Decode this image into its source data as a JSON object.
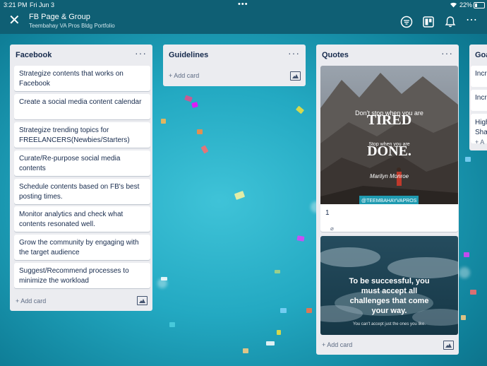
{
  "status_bar": {
    "time": "3:21 PM",
    "date": "Fri Jun 3",
    "battery": "22%"
  },
  "header": {
    "board_title": "FB Page & Group",
    "team_name": "Teembahay VA Pros Bldg Portfolio",
    "icons": [
      "close-icon",
      "filter-icon",
      "board-view-icon",
      "bell-icon",
      "more-icon"
    ]
  },
  "lists": {
    "facebook": {
      "title": "Facebook",
      "cards": [
        "Strategize contents that works on Facebook",
        "Create a social media content calendar",
        "Strategize trending topics for FREELANCERS(Newbies/Starters)",
        "Curate/Re-purpose social media contents",
        "Schedule contents based on FB's best posting times.",
        "Monitor analytics and check what contents resonated well.",
        "Grow the community by engaging with the target audience",
        "Suggest/Recommend processes to minimize the workload"
      ],
      "add_card": "+ Add card"
    },
    "guidelines": {
      "title": "Guidelines",
      "add_card": "+ Add card"
    },
    "quotes": {
      "title": "Quotes",
      "card1": {
        "image_text": {
          "line1": "Don't stop when you are",
          "line2": "TIRED",
          "line3": "Stop when you are",
          "line4": "DONE.",
          "author": "Marilyn Monroe",
          "handle": "@TEEMBAHAYVAPROS"
        },
        "title": "1",
        "attachments": "2"
      },
      "card2": {
        "image_text": {
          "main": "To be successful, you must accept all challenges that come your way.",
          "sub": "You can't accept just the ones you like."
        }
      },
      "add_card": "+ Add card"
    },
    "goals": {
      "title": "Goa",
      "cards": [
        "Incr",
        "Incr",
        "High Sha"
      ],
      "add_card": "+ A"
    }
  }
}
